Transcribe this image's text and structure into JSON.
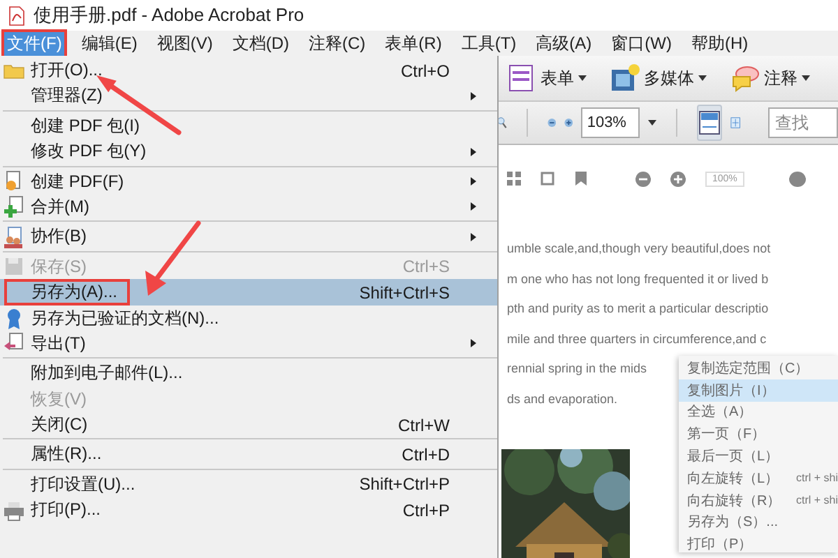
{
  "window": {
    "title": "使用手册.pdf - Adobe Acrobat Pro"
  },
  "menu_bar": [
    {
      "label": "文件(F)",
      "selected": true,
      "annotated": true
    },
    {
      "label": "编辑(E)",
      "selected": false,
      "annotated": false
    },
    {
      "label": "视图(V)",
      "selected": false,
      "annotated": false
    },
    {
      "label": "文档(D)",
      "selected": false,
      "annotated": false
    },
    {
      "label": "注释(C)",
      "selected": false,
      "annotated": false
    },
    {
      "label": "表单(R)",
      "selected": false,
      "annotated": false
    },
    {
      "label": "工具(T)",
      "selected": false,
      "annotated": false
    },
    {
      "label": "高级(A)",
      "selected": false,
      "annotated": false
    },
    {
      "label": "窗口(W)",
      "selected": false,
      "annotated": false
    },
    {
      "label": "帮助(H)",
      "selected": false,
      "annotated": false
    }
  ],
  "file_menu": [
    {
      "kind": "item",
      "label": "打开(O)...",
      "shortcut": "Ctrl+O",
      "submenu": false,
      "disabled": false,
      "selected": false,
      "annotated": false
    },
    {
      "kind": "item",
      "label": "管理器(Z)",
      "submenu": true,
      "disabled": false,
      "selected": false,
      "annotated": false
    },
    {
      "kind": "separator"
    },
    {
      "kind": "item",
      "label": "创建 PDF 包(I)",
      "submenu": false,
      "disabled": false,
      "selected": false,
      "annotated": false
    },
    {
      "kind": "item",
      "label": "修改 PDF 包(Y)",
      "submenu": true,
      "disabled": false,
      "selected": false,
      "annotated": false
    },
    {
      "kind": "separator"
    },
    {
      "kind": "item",
      "label": "创建 PDF(F)",
      "submenu": true,
      "disabled": false,
      "selected": false,
      "annotated": false
    },
    {
      "kind": "item",
      "label": "合并(M)",
      "submenu": true,
      "disabled": false,
      "selected": false,
      "annotated": false
    },
    {
      "kind": "separator"
    },
    {
      "kind": "item",
      "label": "协作(B)",
      "submenu": true,
      "disabled": false,
      "selected": false,
      "annotated": false
    },
    {
      "kind": "separator"
    },
    {
      "kind": "item",
      "label": "保存(S)",
      "shortcut": "Ctrl+S",
      "submenu": false,
      "disabled": true,
      "selected": false,
      "annotated": false
    },
    {
      "kind": "item",
      "label": "另存为(A)...",
      "shortcut": "Shift+Ctrl+S",
      "submenu": false,
      "disabled": false,
      "selected": true,
      "annotated": true
    },
    {
      "kind": "item",
      "label": "另存为已验证的文档(N)...",
      "submenu": false,
      "disabled": false,
      "selected": false,
      "annotated": false
    },
    {
      "kind": "item",
      "label": "导出(T)",
      "submenu": true,
      "disabled": false,
      "selected": false,
      "annotated": false
    },
    {
      "kind": "separator"
    },
    {
      "kind": "item",
      "label": "附加到电子邮件(L)...",
      "submenu": false,
      "disabled": false,
      "selected": false,
      "annotated": false
    },
    {
      "kind": "item",
      "label": "恢复(V)",
      "submenu": false,
      "disabled": true,
      "selected": false,
      "annotated": false
    },
    {
      "kind": "item",
      "label": "关闭(C)",
      "shortcut": "Ctrl+W",
      "submenu": false,
      "disabled": false,
      "selected": false,
      "annotated": false
    },
    {
      "kind": "separator"
    },
    {
      "kind": "item",
      "label": "属性(R)...",
      "shortcut": "Ctrl+D",
      "submenu": false,
      "disabled": false,
      "selected": false,
      "annotated": false
    },
    {
      "kind": "separator"
    },
    {
      "kind": "item",
      "label": "打印设置(U)...",
      "shortcut": "Shift+Ctrl+P",
      "submenu": false,
      "disabled": false,
      "selected": false,
      "annotated": false
    },
    {
      "kind": "item",
      "label": "打印(P)...",
      "shortcut": "Ctrl+P",
      "submenu": false,
      "disabled": false,
      "selected": false,
      "annotated": false
    }
  ],
  "toolbar": [
    {
      "label": "表单"
    },
    {
      "label": "多媒体"
    },
    {
      "label": "注释"
    }
  ],
  "view_toolbar": {
    "zoom": "103%",
    "find": {
      "placeholder": "查找"
    }
  },
  "document": {
    "zoom": "100%",
    "lines": [
      "umble scale,and,though very beautiful,does not",
      "m one who has not long frequented it or lived b",
      "pth and purity as to merit a particular descriptio",
      "mile and three quarters in circumference,and c",
      "rennial spring in the mids",
      "ds and evaporation."
    ]
  },
  "context_menu": [
    {
      "label": "复制选定范围（C）",
      "selected": false
    },
    {
      "label": "复制图片（I）",
      "selected": true
    },
    {
      "label": "全选（A）",
      "selected": false
    },
    {
      "label": "第一页（F）",
      "selected": false
    },
    {
      "label": "最后一页（L）",
      "selected": false
    },
    {
      "label": "向左旋转（L）",
      "shortcut": "ctrl + shi",
      "selected": false
    },
    {
      "label": "向右旋转（R）",
      "shortcut": "ctrl + shi",
      "selected": false
    },
    {
      "label": "另存为（S）...",
      "selected": false
    },
    {
      "label": "打印（P）",
      "selected": false
    }
  ]
}
